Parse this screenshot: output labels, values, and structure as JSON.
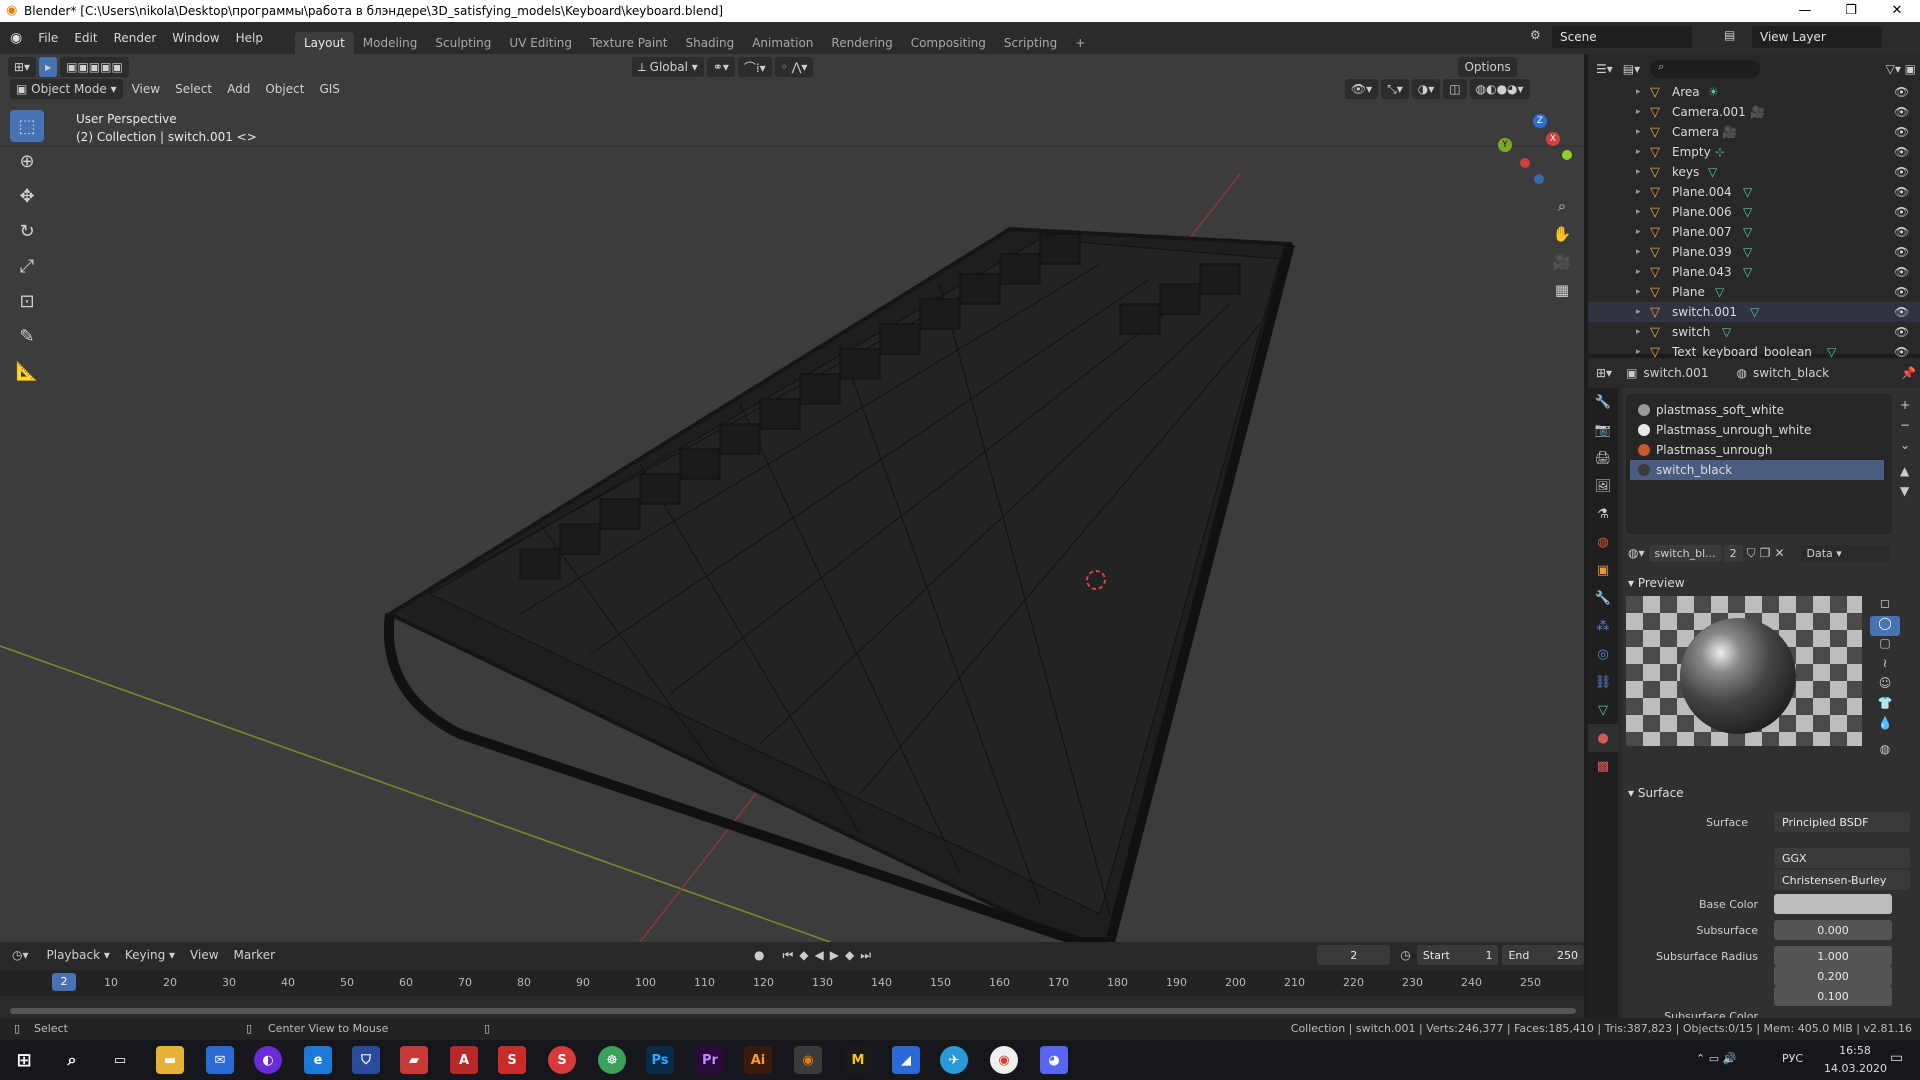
{
  "window": {
    "title": "Blender* [C:\\Users\\nikola\\Desktop\\программы\\работа в блэндере\\3D_satisfying_models\\Keyboard\\keyboard.blend]"
  },
  "menus": [
    "File",
    "Edit",
    "Render",
    "Window",
    "Help"
  ],
  "workspaces": [
    {
      "label": "Layout",
      "active": true
    },
    {
      "label": "Modeling"
    },
    {
      "label": "Sculpting"
    },
    {
      "label": "UV Editing"
    },
    {
      "label": "Texture Paint"
    },
    {
      "label": "Shading"
    },
    {
      "label": "Animation"
    },
    {
      "label": "Rendering"
    },
    {
      "label": "Compositing"
    },
    {
      "label": "Scripting"
    },
    {
      "label": "+"
    }
  ],
  "top_right": {
    "scene": "Scene",
    "view_layer": "View Layer"
  },
  "viewport_header": {
    "orientation": "Global",
    "options": "Options",
    "mode": "Object Mode",
    "menus": [
      "View",
      "Select",
      "Add",
      "Object",
      "GIS"
    ]
  },
  "viewport": {
    "perspective": "User Perspective",
    "collection_info": "(2) Collection | switch.001 <>",
    "gizmo": {
      "z": "Z",
      "y": "Y",
      "x": "X"
    }
  },
  "outliner": {
    "items": [
      {
        "name": "Area",
        "icon": "light-icon"
      },
      {
        "name": "Camera.001",
        "icon": "camera-icon"
      },
      {
        "name": "Camera",
        "icon": "camera-icon"
      },
      {
        "name": "Empty",
        "icon": "empty-icon"
      },
      {
        "name": "keys",
        "icon": "mesh-icon"
      },
      {
        "name": "Plane.004",
        "icon": "mesh-icon"
      },
      {
        "name": "Plane.006",
        "icon": "mesh-icon"
      },
      {
        "name": "Plane.007",
        "icon": "mesh-icon"
      },
      {
        "name": "Plane.039",
        "icon": "mesh-icon"
      },
      {
        "name": "Plane.043",
        "icon": "mesh-icon"
      },
      {
        "name": "Plane",
        "icon": "mesh-icon"
      },
      {
        "name": "switch.001",
        "icon": "mesh-icon"
      },
      {
        "name": "switch",
        "icon": "mesh-icon"
      },
      {
        "name": "Text_keyboard_boolean",
        "icon": "mesh-icon"
      }
    ]
  },
  "properties": {
    "object": "switch.001",
    "material": "switch_black",
    "materials": [
      {
        "name": "plastmass_soft_white",
        "color": "#9a9a9a"
      },
      {
        "name": "Plastmass_unrough_white",
        "color": "#e8e8e8"
      },
      {
        "name": "Plastmass_unrough",
        "color": "#c85a2a"
      },
      {
        "name": "switch_black",
        "color": "#3a3a3a",
        "selected": true
      }
    ],
    "slot_name": "switch_bl...",
    "users": "2",
    "link": "Data",
    "preview_label": "Preview",
    "surface_label": "Surface",
    "surface": {
      "surface_key": "Surface",
      "surface_value": "Principled BSDF",
      "distribution": "GGX",
      "subsurface_method": "Christensen-Burley",
      "base_color_label": "Base Color",
      "subsurface_label": "Subsurface",
      "subsurface_value": "0.000",
      "subsurface_radius_label": "Subsurface Radius",
      "radius": [
        "1.000",
        "0.200",
        "0.100"
      ],
      "subsurface_color_label": "Subsurface Color"
    }
  },
  "timeline": {
    "menus": [
      "Playback",
      "Keying",
      "View",
      "Marker"
    ],
    "current_frame": "2",
    "start_label": "Start",
    "start": "1",
    "end_label": "End",
    "end": "250",
    "ticks": [
      "10",
      "20",
      "30",
      "40",
      "50",
      "60",
      "70",
      "80",
      "90",
      "100",
      "110",
      "120",
      "130",
      "140",
      "150",
      "160",
      "170",
      "180",
      "190",
      "200",
      "210",
      "220",
      "230",
      "240",
      "250"
    ]
  },
  "statusbar": {
    "left": "Select",
    "middle": "Center View to Mouse",
    "right": "Collection | switch.001 | Verts:246,377 | Faces:185,410 | Tris:387,823 | Objects:0/15 | Mem: 405.0 MiB | v2.81.16"
  },
  "taskbar": {
    "lang": "РУС",
    "time": "16:58",
    "date": "14.03.2020"
  }
}
